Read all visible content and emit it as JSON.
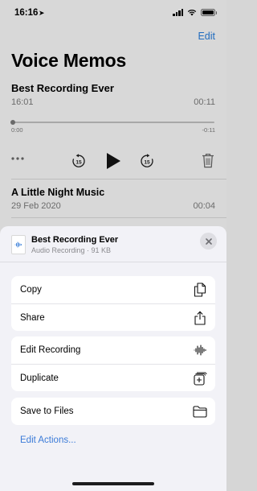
{
  "status_bar": {
    "time": "16:16",
    "location_arrow": "➤"
  },
  "background": {
    "edit_label": "Edit",
    "title": "Voice Memos",
    "current_recording": {
      "title": "Best Recording Ever",
      "time": "16:01",
      "duration": "00:11",
      "scrub_start": "0:00",
      "scrub_end": "-0:11"
    },
    "skip_back_label": "15",
    "skip_forward_label": "15",
    "next_recording": {
      "title": "A Little Night Music",
      "date": "29 Feb 2020",
      "duration": "00:04"
    }
  },
  "sheet": {
    "file_title": "Best Recording Ever",
    "file_subtitle": "Audio Recording · 91 KB",
    "groups": [
      [
        {
          "label": "Copy",
          "icon": "copy-icon"
        },
        {
          "label": "Share",
          "icon": "share-icon"
        }
      ],
      [
        {
          "label": "Edit Recording",
          "icon": "waveform-icon"
        },
        {
          "label": "Duplicate",
          "icon": "duplicate-icon"
        }
      ],
      [
        {
          "label": "Save to Files",
          "icon": "folder-icon"
        }
      ]
    ],
    "edit_actions_label": "Edit Actions..."
  },
  "colors": {
    "accent": "#1f6bbf",
    "sheet_bg": "#f2f2f7",
    "dimmed_bg": "#d8d8d8"
  }
}
